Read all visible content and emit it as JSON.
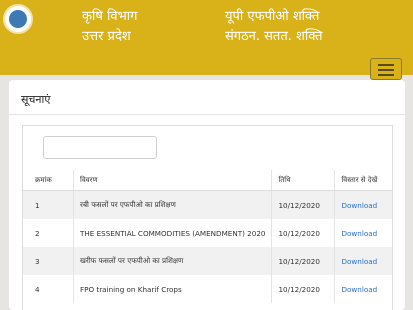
{
  "header": {
    "dept_line1": "कृषि विभाग",
    "dept_line2": "उत्तर प्रदेश",
    "tag_line1": "यूपी एफपीओ शक्ति",
    "tag_line2": "संगठन. सतत. शक्ति",
    "logo_icon": "up-govt-emblem-icon",
    "menu_icon": "hamburger-menu-icon",
    "brand_color": "#d9b21a"
  },
  "panel": {
    "title": "सूचनाएं",
    "search": {
      "value": "",
      "placeholder": ""
    }
  },
  "table": {
    "columns": [
      "क्रमांक",
      "विवरण",
      "तिथि",
      "विस्तार से देखें"
    ],
    "rows": [
      {
        "num": "1",
        "desc": "रबी फसलों पर एफपीओ का प्रशिक्षण",
        "date": "10/12/2020",
        "action": "Download"
      },
      {
        "num": "2",
        "desc": "THE ESSENTIAL COMMODITIES (AMENDMENT) 2020",
        "date": "10/12/2020",
        "action": "Download"
      },
      {
        "num": "3",
        "desc": "खरीफ फसलों पर एफपीओ का प्रशिक्षण",
        "date": "10/12/2020",
        "action": "Download"
      },
      {
        "num": "4",
        "desc": "FPO training on Kharif Crops",
        "date": "10/12/2020",
        "action": "Download"
      }
    ]
  }
}
